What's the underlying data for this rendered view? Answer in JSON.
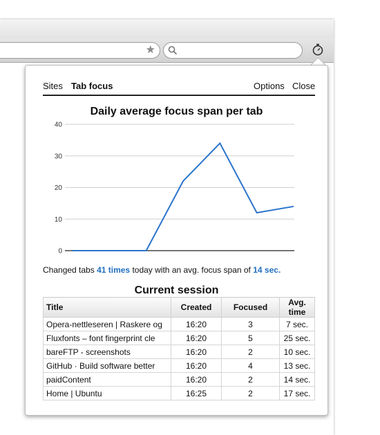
{
  "toolbar": {
    "bookmark_icon": "star-icon",
    "search_icon": "search-icon",
    "extension_icon": "stopwatch-icon"
  },
  "popup": {
    "nav": {
      "sites": "Sites",
      "tab_focus": "Tab focus",
      "options": "Options",
      "close": "Close"
    },
    "summary": {
      "prefix": "Changed tabs",
      "count": "41 times",
      "middle": "today with an avg. focus span of",
      "avg": "14 sec."
    },
    "session_title": "Current session",
    "table": {
      "headers": [
        "Title",
        "Created",
        "Focused",
        "Avg. time"
      ],
      "rows": [
        [
          "Opera-nettleseren | Raskere og",
          "16:20",
          "3",
          "7 sec."
        ],
        [
          "Fluxfonts – font fingerprint cle",
          "16:20",
          "5",
          "25 sec."
        ],
        [
          "bareFTP - screenshots",
          "16:20",
          "2",
          "10 sec."
        ],
        [
          "GitHub · Build software better",
          "16:20",
          "4",
          "13 sec."
        ],
        [
          "paidContent",
          "16:20",
          "2",
          "14 sec."
        ],
        [
          "Home | Ubuntu",
          "16:25",
          "2",
          "17 sec."
        ]
      ]
    }
  },
  "chart_data": {
    "type": "line",
    "title": "Daily average focus span per tab",
    "x": [
      0,
      1,
      2,
      3,
      4,
      5,
      6
    ],
    "series": [
      {
        "values": [
          0,
          0,
          0,
          22,
          34,
          12,
          14
        ]
      }
    ],
    "ylim": [
      0,
      40
    ],
    "yticks": [
      "0",
      "10",
      "20",
      "30",
      "40"
    ],
    "grid": true,
    "color": "#2a74cc"
  }
}
